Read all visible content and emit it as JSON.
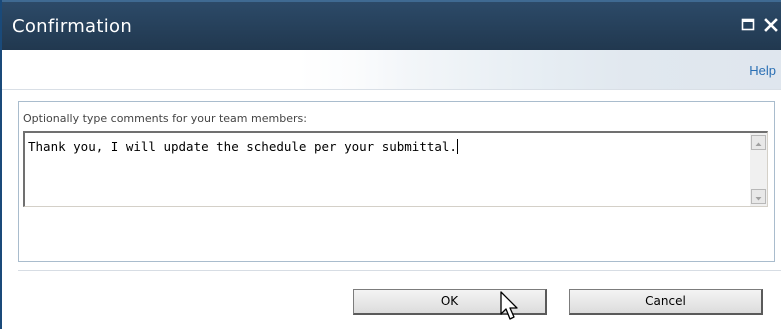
{
  "dialog": {
    "title": "Confirmation",
    "maximize_icon": "maximize-icon",
    "close_icon": "close-icon"
  },
  "ribbon": {
    "help_label": "Help"
  },
  "form": {
    "prompt": "Optionally type comments for your team members:",
    "comment_value": "Thank you, I will update the schedule per your submittal."
  },
  "buttons": {
    "ok_label": "OK",
    "cancel_label": "Cancel"
  },
  "colors": {
    "titlebar": "#21384f",
    "link": "#2a6fb4",
    "panel_border": "#a9bccd"
  }
}
